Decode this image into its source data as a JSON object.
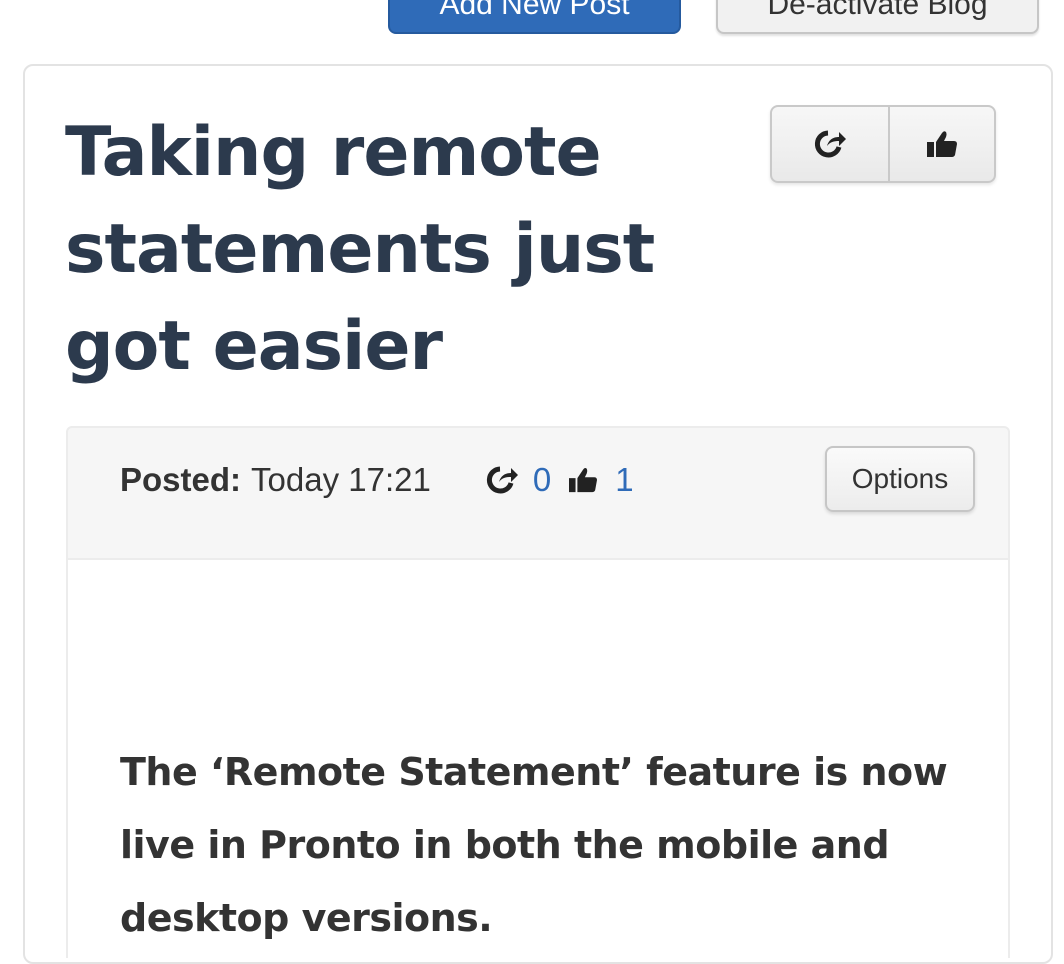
{
  "toolbar": {
    "add_post_label": "Add New Post",
    "deactivate_label": "De-activate Blog"
  },
  "post": {
    "title": "Taking remote statements just got easier",
    "posted_label": "Posted:",
    "posted_time": "Today 17:21",
    "share_count": "0",
    "like_count": "1",
    "options_label": "Options",
    "body": "The ‘Remote Statement’ feature is now live in Pronto in both the mobile and desktop versions."
  },
  "icons": {
    "share": "share-icon",
    "like": "thumbs-up-icon"
  },
  "colors": {
    "primary": "#2f6bb8",
    "title": "#2c3a4d",
    "count": "#2f6bb8"
  }
}
